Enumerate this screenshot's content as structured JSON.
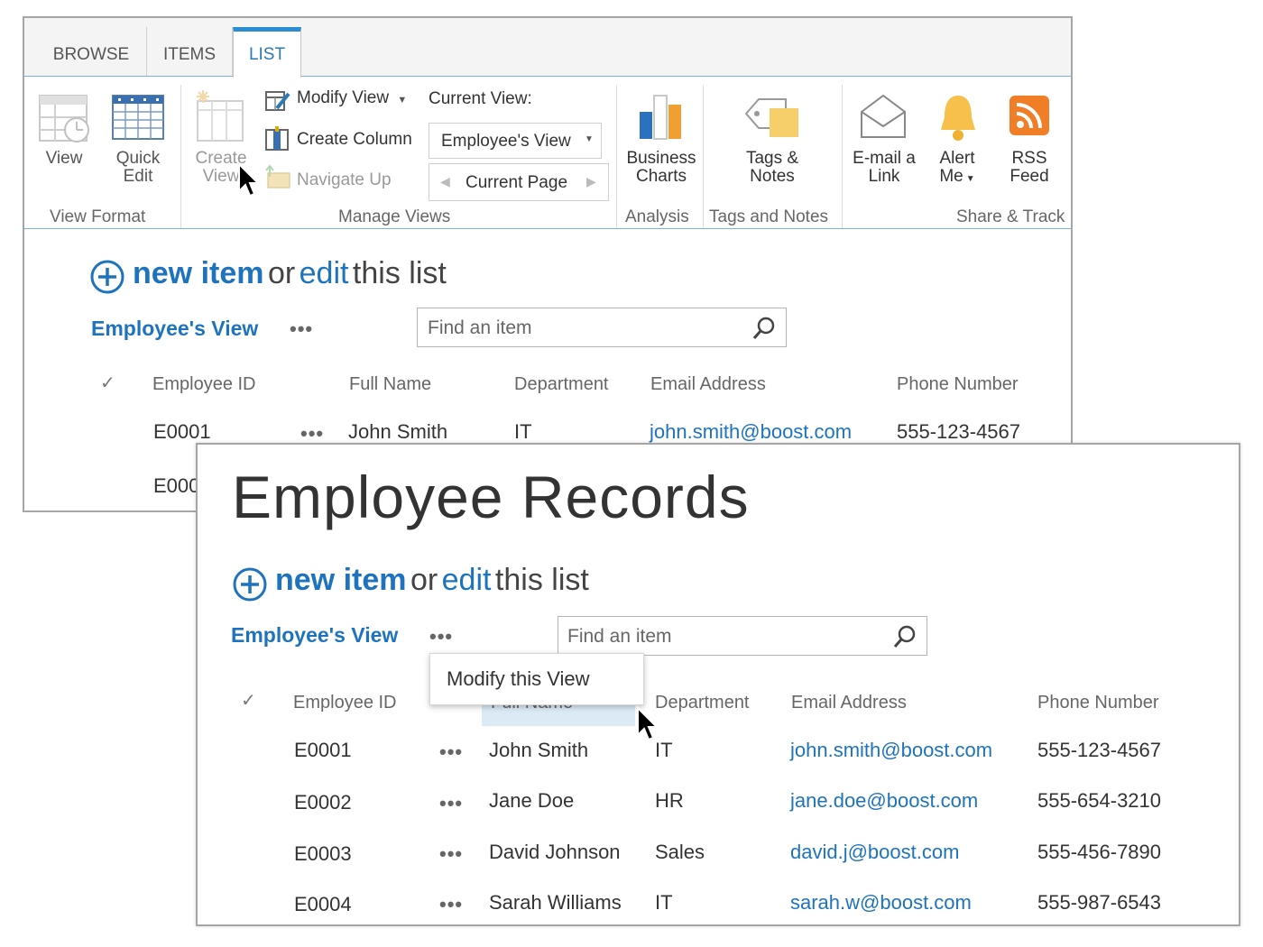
{
  "ribbon": {
    "tabs": [
      {
        "label": "BROWSE"
      },
      {
        "label": "ITEMS"
      },
      {
        "label": "LIST"
      }
    ],
    "view_format": {
      "view_l1": "View",
      "quick_edit_l1": "Quick",
      "quick_edit_l2": "Edit",
      "group_label": "View Format"
    },
    "manage_views": {
      "create_view_l1": "Create",
      "create_view_l2": "View",
      "modify_view": "Modify View",
      "create_column": "Create Column",
      "navigate_up": "Navigate Up",
      "current_view_label": "Current View:",
      "current_view_value": "Employee's View",
      "current_page": "Current Page",
      "group_label": "Manage Views"
    },
    "analysis": {
      "business_l1": "Business",
      "business_l2": "Charts",
      "group_label": "Analysis"
    },
    "tags_notes": {
      "tags_l1": "Tags &",
      "tags_l2": "Notes",
      "group_label": "Tags and Notes"
    },
    "share_track": {
      "email_l1": "E-mail a",
      "email_l2": "Link",
      "alert_l1": "Alert",
      "alert_l2": "Me",
      "rss_l1": "RSS",
      "rss_l2": "Feed",
      "group_label": "Share & Track"
    }
  },
  "list": {
    "title": "Employee Records",
    "new_item": "new item",
    "or": "or",
    "edit": "edit",
    "this_list": "this list",
    "view_name": "Employee's View",
    "ellipsis": "•••",
    "search_placeholder": "Find an item",
    "popup_item": "Modify this View",
    "check": "✓",
    "columns": {
      "id": "Employee ID",
      "name": "Full Name",
      "dept": "Department",
      "email": "Email Address",
      "phone": "Phone Number"
    },
    "rows": [
      {
        "id": "E0001",
        "name": "John Smith",
        "dept": "IT",
        "email": "john.smith@boost.com",
        "phone": "555-123-4567"
      },
      {
        "id": "E0002",
        "name": "Jane Doe",
        "dept": "HR",
        "email": "jane.doe@boost.com",
        "phone": "555-654-3210"
      },
      {
        "id": "E0003",
        "name": "David Johnson",
        "dept": "Sales",
        "email": "david.j@boost.com",
        "phone": "555-456-7890"
      },
      {
        "id": "E0004",
        "name": "Sarah Williams",
        "dept": "IT",
        "email": "sarah.w@boost.com",
        "phone": "555-987-6543"
      }
    ],
    "partial_row_id": "E000"
  },
  "colors": {
    "accent": "#1e73be",
    "tab_border": "#2a8dd4"
  },
  "icons": [
    "view-icon",
    "quick-edit-icon",
    "create-view-icon",
    "modify-view-icon",
    "create-column-icon",
    "navigate-up-icon",
    "business-charts-icon",
    "tags-notes-icon",
    "email-link-icon",
    "alert-me-icon",
    "rss-feed-icon",
    "add-circle-icon",
    "search-icon",
    "checkmark-icon",
    "mouse-pointer-icon"
  ]
}
